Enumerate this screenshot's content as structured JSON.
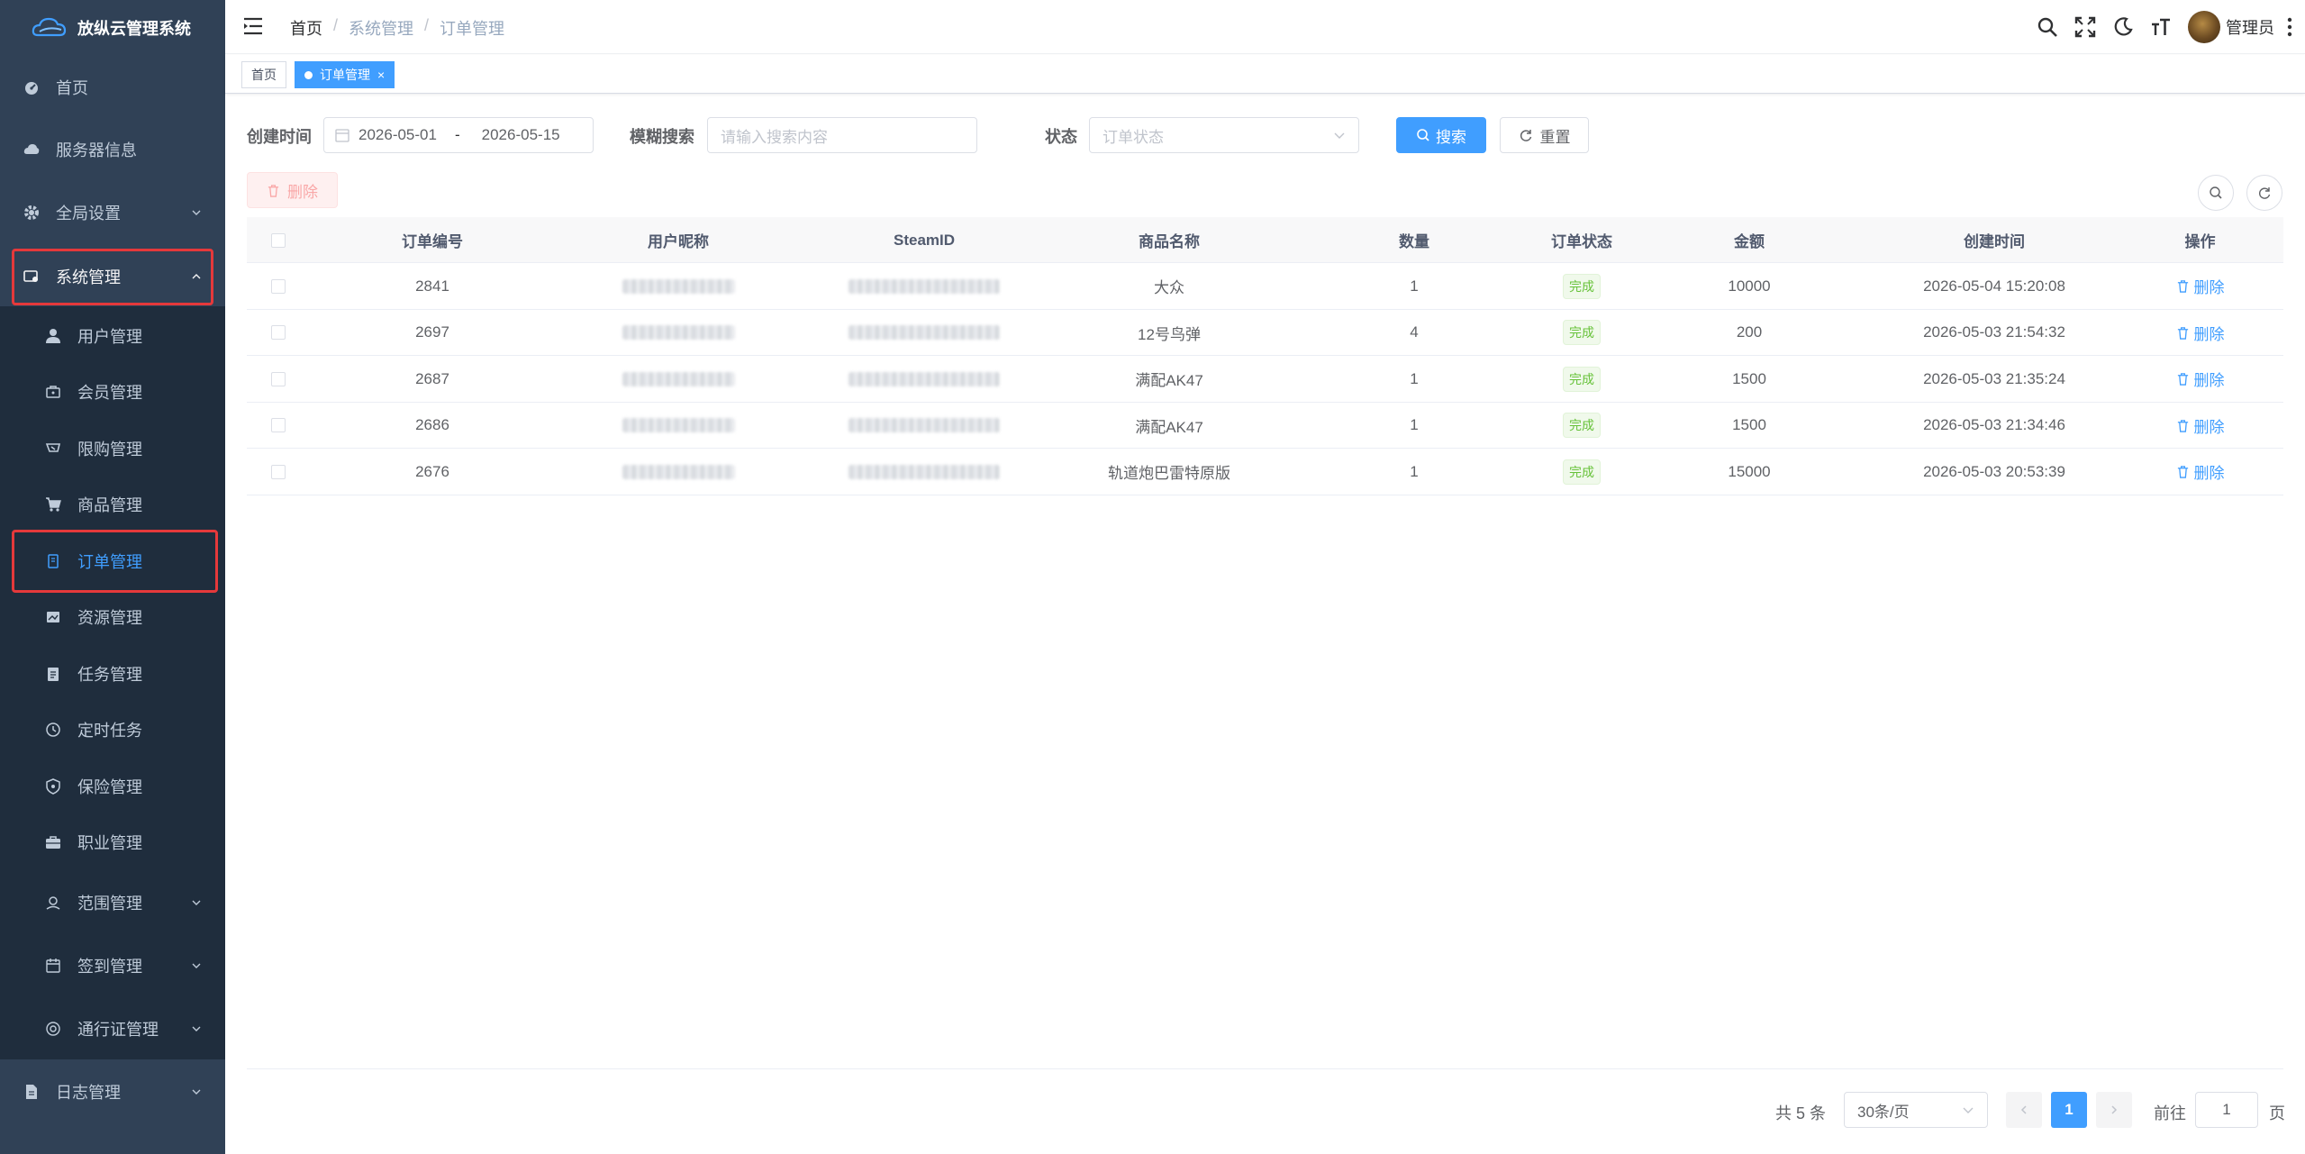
{
  "app": {
    "title": "放纵云管理系统"
  },
  "sidebar": {
    "items": [
      {
        "label": "首页",
        "icon": "dashboard-icon"
      },
      {
        "label": "服务器信息",
        "icon": "cloud-icon"
      },
      {
        "label": "全局设置",
        "icon": "gear-icon"
      },
      {
        "label": "系统管理",
        "icon": "system-icon"
      },
      {
        "label": "用户管理",
        "icon": "user-icon"
      },
      {
        "label": "会员管理",
        "icon": "vip-icon"
      },
      {
        "label": "限购管理",
        "icon": "limit-icon"
      },
      {
        "label": "商品管理",
        "icon": "cart-icon"
      },
      {
        "label": "订单管理",
        "icon": "order-icon"
      },
      {
        "label": "资源管理",
        "icon": "resource-icon"
      },
      {
        "label": "任务管理",
        "icon": "task-icon"
      },
      {
        "label": "定时任务",
        "icon": "clock-icon"
      },
      {
        "label": "保险管理",
        "icon": "shield-icon"
      },
      {
        "label": "职业管理",
        "icon": "briefcase-icon"
      },
      {
        "label": "范围管理",
        "icon": "range-icon"
      },
      {
        "label": "签到管理",
        "icon": "calendar-icon"
      },
      {
        "label": "通行证管理",
        "icon": "pass-icon"
      },
      {
        "label": "日志管理",
        "icon": "log-icon"
      }
    ]
  },
  "header": {
    "breadcrumb": [
      "首页",
      "系统管理",
      "订单管理"
    ],
    "user_name": "管理员"
  },
  "tags": [
    {
      "label": "首页"
    },
    {
      "label": "订单管理"
    }
  ],
  "filters": {
    "created_label": "创建时间",
    "date_start": "2026-05-01",
    "date_sep": "-",
    "date_end": "2026-05-15",
    "fuzzy_label": "模糊搜索",
    "fuzzy_placeholder": "请输入搜索内容",
    "status_label": "状态",
    "status_placeholder": "订单状态",
    "search_button": "搜索",
    "reset_button": "重置"
  },
  "toolbar": {
    "delete_button": "删除"
  },
  "table": {
    "columns": [
      "订单编号",
      "用户昵称",
      "SteamID",
      "商品名称",
      "数量",
      "订单状态",
      "金额",
      "创建时间",
      "操作"
    ],
    "rows": [
      {
        "id": "2841",
        "product": "大众",
        "qty": "1",
        "status": "完成",
        "amount": "10000",
        "created": "2026-05-04 15:20:08",
        "op": "删除"
      },
      {
        "id": "2697",
        "product": "12号鸟弹",
        "qty": "4",
        "status": "完成",
        "amount": "200",
        "created": "2026-05-03 21:54:32",
        "op": "删除"
      },
      {
        "id": "2687",
        "product": "满配AK47",
        "qty": "1",
        "status": "完成",
        "amount": "1500",
        "created": "2026-05-03 21:35:24",
        "op": "删除"
      },
      {
        "id": "2686",
        "product": "满配AK47",
        "qty": "1",
        "status": "完成",
        "amount": "1500",
        "created": "2026-05-03 21:34:46",
        "op": "删除"
      },
      {
        "id": "2676",
        "product": "轨道炮巴雷特原版",
        "qty": "1",
        "status": "完成",
        "amount": "15000",
        "created": "2026-05-03 20:53:39",
        "op": "删除"
      }
    ]
  },
  "pagination": {
    "total": "共 5 条",
    "page_size": "30条/页",
    "current_page": "1",
    "goto_label": "前往",
    "goto_value": "1",
    "page_suffix": "页"
  },
  "colors": {
    "primary": "#409eff",
    "sidebar_bg": "#304156",
    "submenu_bg": "#1f2d3d",
    "highlight": "#e5393b",
    "success": "#67c23a"
  }
}
